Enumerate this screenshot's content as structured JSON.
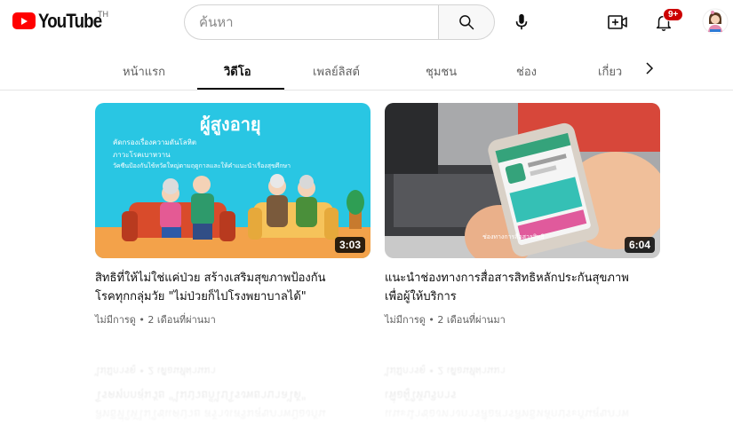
{
  "header": {
    "logo_text": "YouTube",
    "logo_country": "TH",
    "search_placeholder": "ค้นหา",
    "notification_count": "9+"
  },
  "tabs": [
    {
      "label": "หน้าแรก",
      "active": false
    },
    {
      "label": "วิดีโอ",
      "active": true
    },
    {
      "label": "เพลย์ลิสต์",
      "active": false
    },
    {
      "label": "ชุมชน",
      "active": false
    },
    {
      "label": "ช่อง",
      "active": false
    },
    {
      "label": "เกี่ยว",
      "active": false
    }
  ],
  "videos": [
    {
      "thumb_heading": "ผู้สูงอายุ",
      "thumb_lines": [
        "คัดกรองเรื่องความดันโลหิต",
        "ภาวะโรคเบาหวาน",
        "วัคซีนป้องกันไข้หวัดใหญ่ตามฤดูกาลและให้คำแนะนำเรื่องสุขศึกษา"
      ],
      "duration": "3:03",
      "title_line1": "สิทธิที่ให้ไม่ใช่แค่ป่วย สร้างเสริมสุขภาพป้องกัน",
      "title_line2": "โรคทุกกลุ่มวัย \"ไม่ป่วยก็ไปโรงพยาบาลได้\"",
      "meta": "ไม่มีการดู • 2 เดือนที่ผ่านมา"
    },
    {
      "thumb_caption": "ช่องทางการสื่อสารสิทธิ",
      "duration": "6:04",
      "title_line1": "แนะนำช่องทางการสื่อสารสิทธิหลักประกันสุขภาพ",
      "title_line2": "เพื่อผู้ให้บริการ",
      "meta": "ไม่มีการดู • 2 เดือนที่ผ่านมา"
    }
  ],
  "colors": {
    "brand_red": "#ff0000",
    "thumb1_bg": "#29c6e3",
    "thumb1_floor": "#f3a24a",
    "text_primary": "#0f0f0f",
    "text_secondary": "#606060"
  }
}
